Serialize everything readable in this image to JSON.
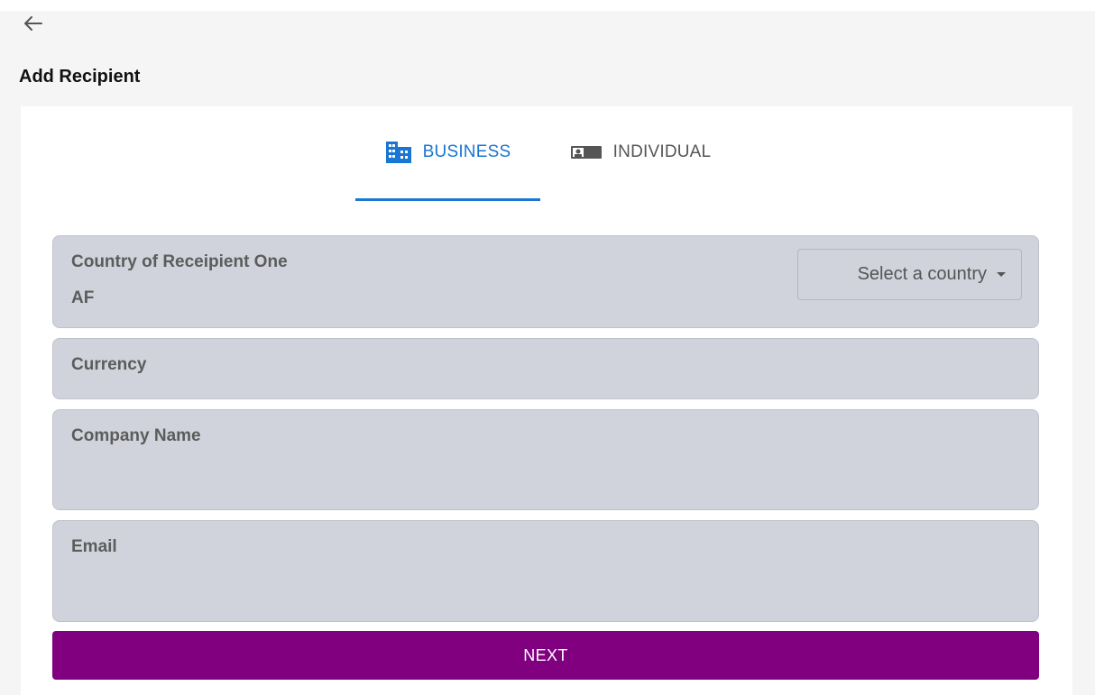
{
  "header": {
    "back_icon": "arrow-left-icon",
    "title": "Add Recipient"
  },
  "tabs": [
    {
      "label": "BUSINESS",
      "icon": "building-icon",
      "active": true
    },
    {
      "label": "INDIVIDUAL",
      "icon": "id-card-icon",
      "active": false
    }
  ],
  "form": {
    "country": {
      "label": "Country of Receipient One",
      "value": "AF",
      "select_placeholder": "Select a country",
      "select_icon": "caret-down-icon"
    },
    "currency": {
      "label": "Currency"
    },
    "company_name": {
      "label": "Company Name"
    },
    "email": {
      "label": "Email"
    },
    "next_label": "NEXT"
  },
  "colors": {
    "accent": "#1976d2",
    "primary_button": "#800080",
    "field_bg": "#d0d3db",
    "page_bg": "#f5f5f5"
  }
}
